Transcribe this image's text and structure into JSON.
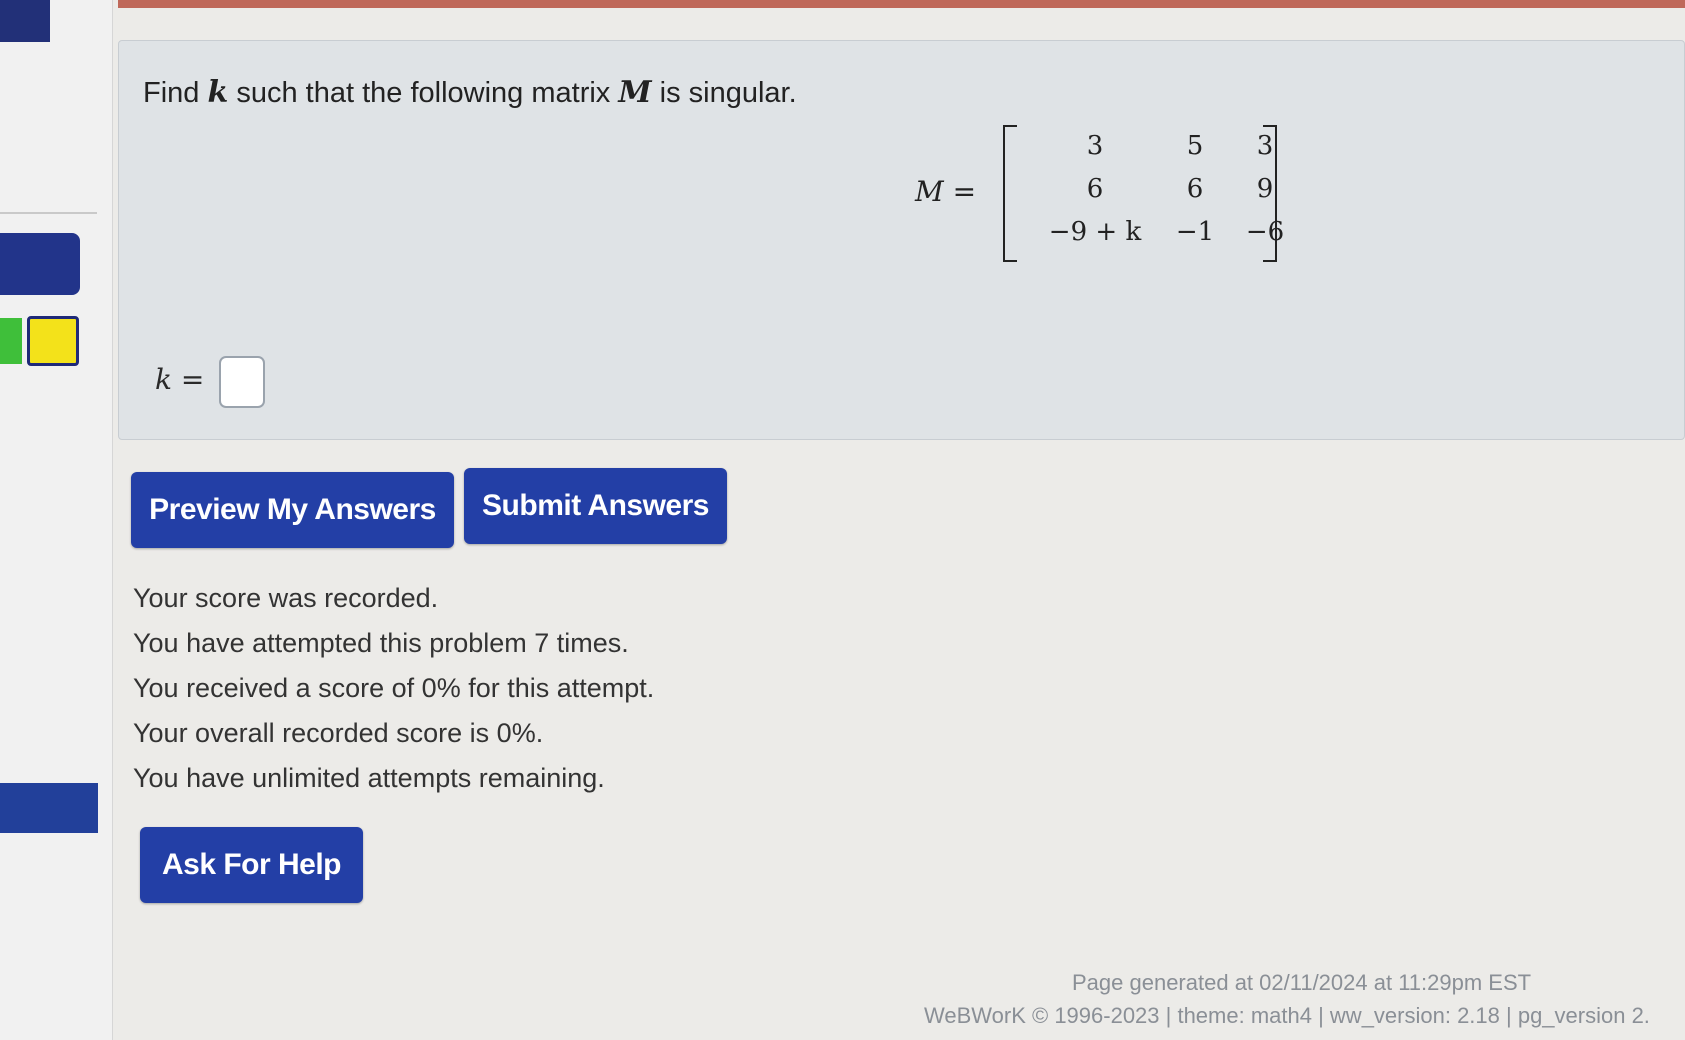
{
  "problem": {
    "prompt": "Find k such that the following matrix M is singular.",
    "prompt_parts": {
      "before_k": "Find ",
      "k": "k",
      "middle": " such that the following matrix ",
      "m": "M",
      "after": " is singular."
    },
    "matrix_lhs": "M =",
    "matrix_name": "M",
    "matrix": [
      [
        "3",
        "5",
        "3"
      ],
      [
        "6",
        "6",
        "9"
      ],
      [
        "−9 + k",
        "−1",
        "−6"
      ]
    ],
    "answer_label_var": "k",
    "answer_label_eq": " =",
    "answer_value": "",
    "answer_placeholder": ""
  },
  "buttons": {
    "preview_label": "Preview My Answers",
    "submit_label": "Submit Answers",
    "help_label": "Ask For Help"
  },
  "messages": [
    "Your score was recorded.",
    "You have attempted this problem 7 times.",
    "You received a score of 0% for this attempt.",
    "Your overall recorded score is 0%.",
    "You have unlimited attempts remaining."
  ],
  "footer": {
    "generated": "Page generated at 02/11/2024 at 11:29pm EST",
    "copyright": "WeBWorK © 1996-2023 | theme: math4 | ww_version: 2.18 | pg_version 2."
  },
  "colors": {
    "button_blue": "#233fa6",
    "sidebar_nav_blue": "#22348a",
    "status_green": "#3fbf3a",
    "status_yellow": "#f3e21a"
  }
}
